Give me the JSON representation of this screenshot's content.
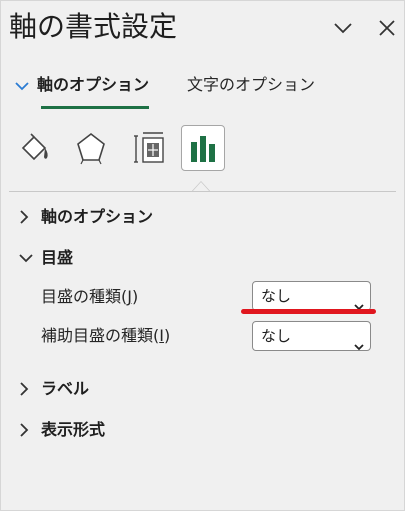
{
  "pane": {
    "title": "軸の書式設定"
  },
  "tabs": {
    "axis_options": "軸のオプション",
    "text_options": "文字のオプション"
  },
  "category_icons": [
    "fill-line-icon",
    "effects-icon",
    "size-properties-icon",
    "axis-options-icon"
  ],
  "sections": {
    "axis_options": "軸のオプション",
    "tickmarks": "目盛",
    "labels": "ラベル",
    "number": "表示形式"
  },
  "tickmarks": {
    "major_label_main": "目盛の種類(",
    "major_label_key": "J",
    "major_label_end": ")",
    "major_value": "なし",
    "minor_label_main": "補助目盛の種類(",
    "minor_label_key": "I",
    "minor_label_end": ")",
    "minor_value": "なし"
  },
  "colors": {
    "accent_green": "#1e7145",
    "annotation_red": "#e0161e",
    "chevron_blue": "#2b7cd3"
  }
}
